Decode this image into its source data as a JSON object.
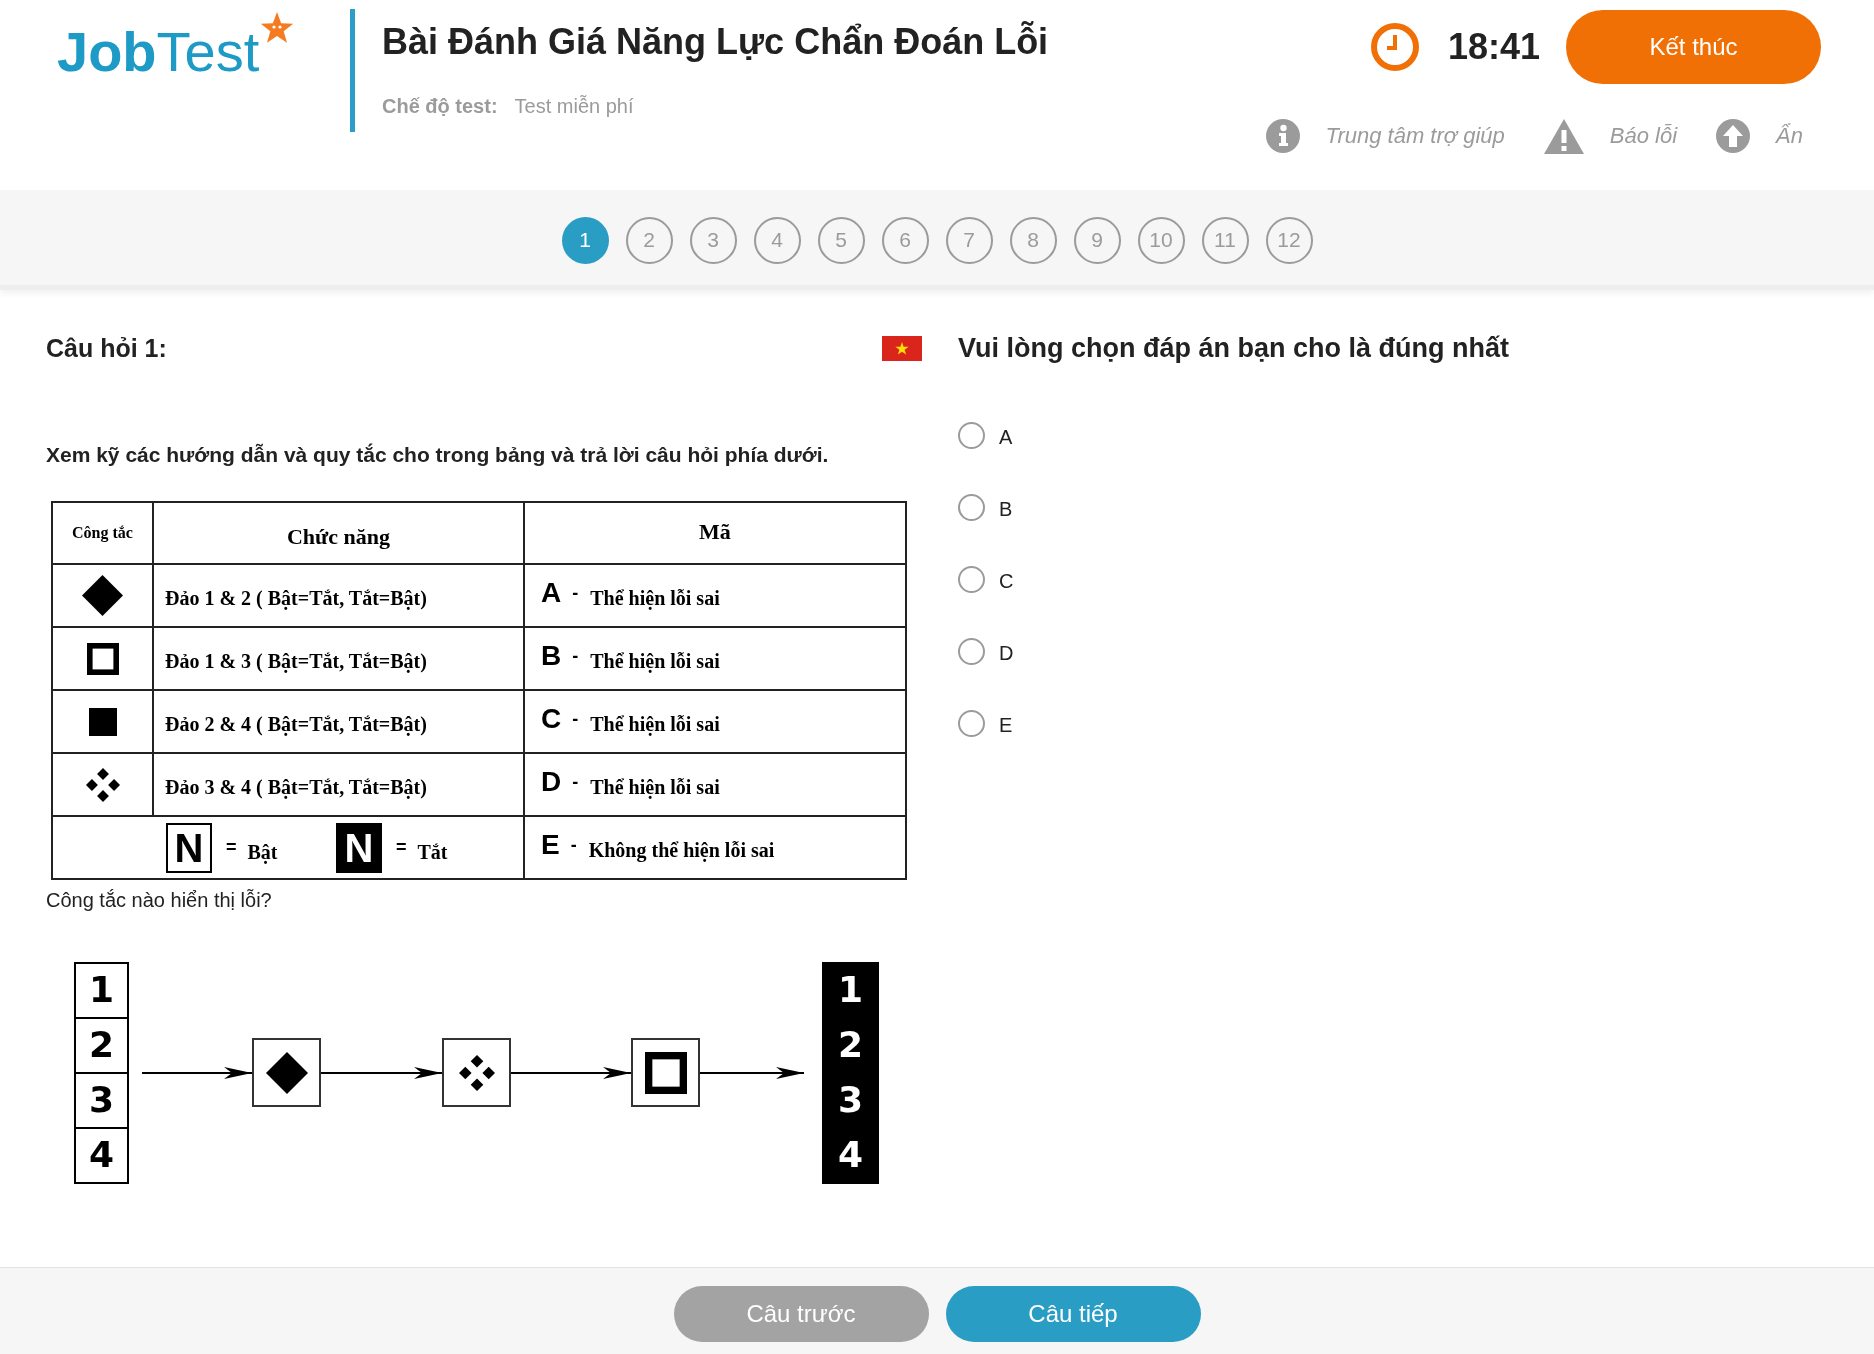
{
  "header": {
    "logo": "**Job**Test",
    "title": "Bài Đánh Giá Năng Lực Chẩn Đoán Lỗi",
    "mode_label": "Chế độ test:",
    "mode_value": "Test miễn phí",
    "timer": "18:41",
    "finish_button": "Kết thúc",
    "links": [
      {
        "kind": "info",
        "label": "Trung tâm trợ giúp"
      },
      {
        "kind": "warning",
        "label": "Báo lỗi"
      },
      {
        "kind": "hide",
        "label": "Ẩn"
      }
    ]
  },
  "question_nav": [
    {
      "label": "1",
      "selected": true
    },
    {
      "label": "2",
      "selected": false
    },
    {
      "label": "3",
      "selected": false
    },
    {
      "label": "4",
      "selected": false
    },
    {
      "label": "5",
      "selected": false
    },
    {
      "label": "6",
      "selected": false
    },
    {
      "label": "7",
      "selected": false
    },
    {
      "label": "8",
      "selected": false
    },
    {
      "label": "9",
      "selected": false
    },
    {
      "label": "10",
      "selected": false
    },
    {
      "label": "11",
      "selected": false
    },
    {
      "label": "12",
      "selected": false
    }
  ],
  "question": {
    "heading": "Câu hỏi 1:",
    "instruction": "Xem kỹ các hướng dẫn và quy tắc cho trong bảng và trả lời câu hỏi phía dưới.",
    "rules_table": {
      "columns": [
        "Công tắc",
        "Chức năng",
        "Mã"
      ],
      "rows": [
        {
          "kind": "diamond",
          "function": "Đảo 1 & 2 ( Bật=Tắt, Tắt=Bật)",
          "code": "A",
          "dash": "-",
          "meaning": "Thể hiện lỗi sai"
        },
        {
          "kind": "hollow",
          "function": "Đảo 1 & 3 ( Bật=Tắt, Tắt=Bật)",
          "code": "B",
          "dash": "-",
          "meaning": "Thể hiện lỗi sai"
        },
        {
          "kind": "solid",
          "function": "Đảo 2 & 4 ( Bật=Tắt, Tắt=Bật)",
          "code": "C",
          "dash": "-",
          "meaning": "Thể hiện lỗi sai"
        },
        {
          "kind": "cluster",
          "function": "Đảo 3 & 4 ( Bật=Tắt, Tắt=Bật)",
          "code": "D",
          "dash": "-",
          "meaning": "Thể hiện lỗi sai"
        }
      ],
      "legend": {
        "items": [
          {
            "letter": "N",
            "on": true,
            "sign": "=",
            "label": "Bật"
          },
          {
            "letter": "N",
            "on": false,
            "sign": "=",
            "label": "Tắt"
          }
        ],
        "code": "E",
        "dash": "-",
        "meaning": "Không thể hiện lỗi sai"
      }
    },
    "prompt": "Công tắc nào hiển thị lỗi?",
    "diagram": {
      "inputs": [
        {
          "label": "1",
          "on": true
        },
        {
          "label": "2",
          "on": true
        },
        {
          "label": "3",
          "on": true
        },
        {
          "label": "4",
          "on": true
        }
      ],
      "switches": [
        {
          "kind": "diamond"
        },
        {
          "kind": "cluster"
        },
        {
          "kind": "hollow"
        }
      ],
      "outputs": [
        {
          "label": "1",
          "on": false
        },
        {
          "label": "2",
          "on": false
        },
        {
          "label": "3",
          "on": false
        },
        {
          "label": "4",
          "on": false
        }
      ]
    }
  },
  "answers": {
    "heading": "Vui lòng chọn đáp án bạn cho là đúng nhất",
    "options": [
      {
        "label": "A",
        "selected": false
      },
      {
        "label": "B",
        "selected": false
      },
      {
        "label": "C",
        "selected": false
      },
      {
        "label": "D",
        "selected": false
      },
      {
        "label": "E",
        "selected": false
      }
    ]
  },
  "footer": {
    "buttons": [
      {
        "label": "Câu trước",
        "disabled": true
      },
      {
        "label": "Câu tiếp",
        "disabled": false
      }
    ]
  }
}
